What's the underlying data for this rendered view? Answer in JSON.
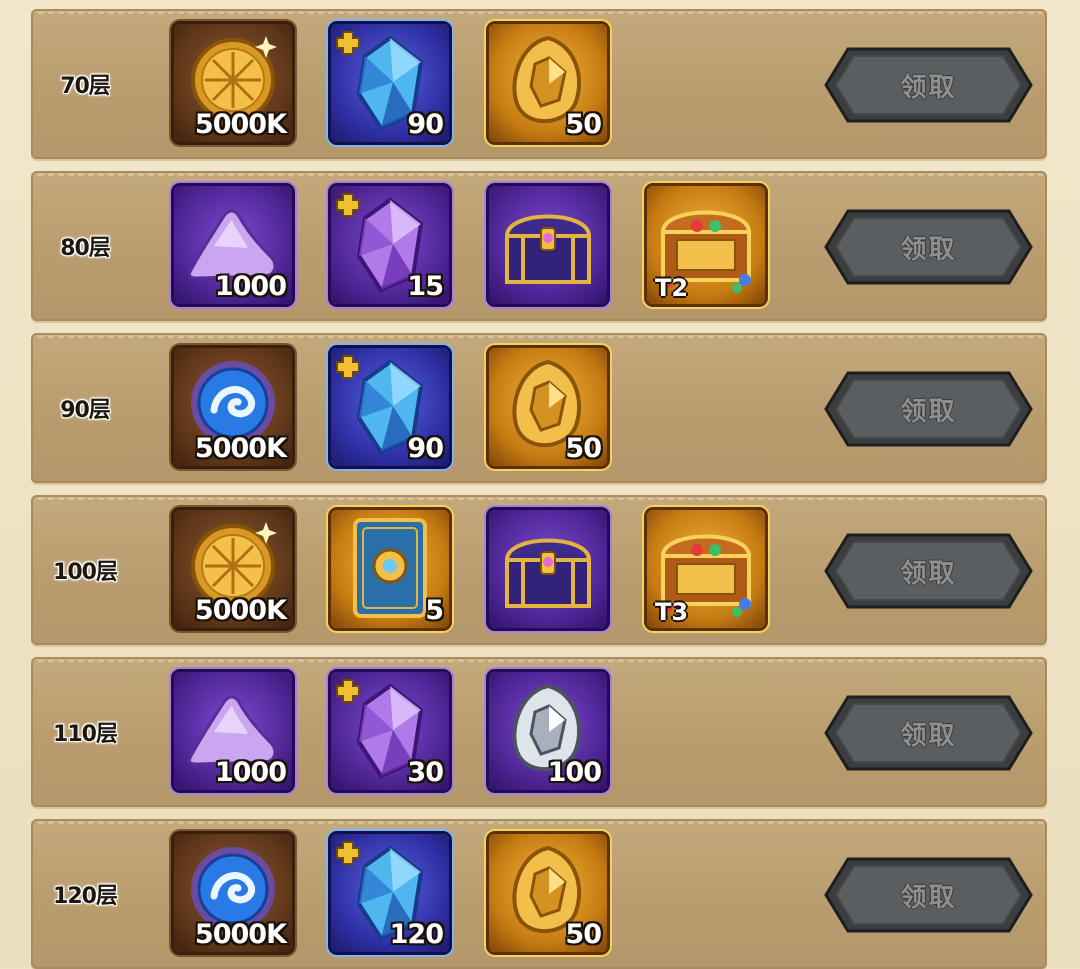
{
  "claim_label": "领取",
  "rows": [
    {
      "floor": "70层",
      "items": [
        {
          "icon": "gold-compass-coin-icon",
          "qty": "5000K"
        },
        {
          "icon": "blue-crystal-shard-icon",
          "qty": "90"
        },
        {
          "icon": "gold-medal-icon",
          "qty": "50"
        }
      ]
    },
    {
      "floor": "80层",
      "items": [
        {
          "icon": "purple-dust-icon",
          "qty": "1000"
        },
        {
          "icon": "purple-crystal-shard-icon",
          "qty": "15"
        },
        {
          "icon": "purple-chest-icon",
          "qty": ""
        },
        {
          "icon": "gold-treasure-chest-icon",
          "tier": "T2"
        }
      ]
    },
    {
      "floor": "90层",
      "items": [
        {
          "icon": "blue-swirl-orb-icon",
          "qty": "5000K"
        },
        {
          "icon": "blue-crystal-shard-icon",
          "qty": "90"
        },
        {
          "icon": "gold-medal-icon",
          "qty": "50"
        }
      ]
    },
    {
      "floor": "100层",
      "items": [
        {
          "icon": "gold-compass-coin-icon",
          "qty": "5000K"
        },
        {
          "icon": "ornate-card-icon",
          "qty": "5"
        },
        {
          "icon": "purple-chest-icon",
          "qty": ""
        },
        {
          "icon": "gold-treasure-chest-icon",
          "tier": "T3"
        }
      ]
    },
    {
      "floor": "110层",
      "items": [
        {
          "icon": "purple-dust-icon",
          "qty": "1000"
        },
        {
          "icon": "purple-crystal-shard-icon",
          "qty": "30"
        },
        {
          "icon": "silver-medal-icon",
          "qty": "100"
        }
      ]
    },
    {
      "floor": "120层",
      "items": [
        {
          "icon": "blue-swirl-orb-icon",
          "qty": "5000K"
        },
        {
          "icon": "blue-crystal-shard-icon",
          "qty": "120"
        },
        {
          "icon": "gold-medal-icon",
          "qty": "50"
        }
      ]
    }
  ]
}
